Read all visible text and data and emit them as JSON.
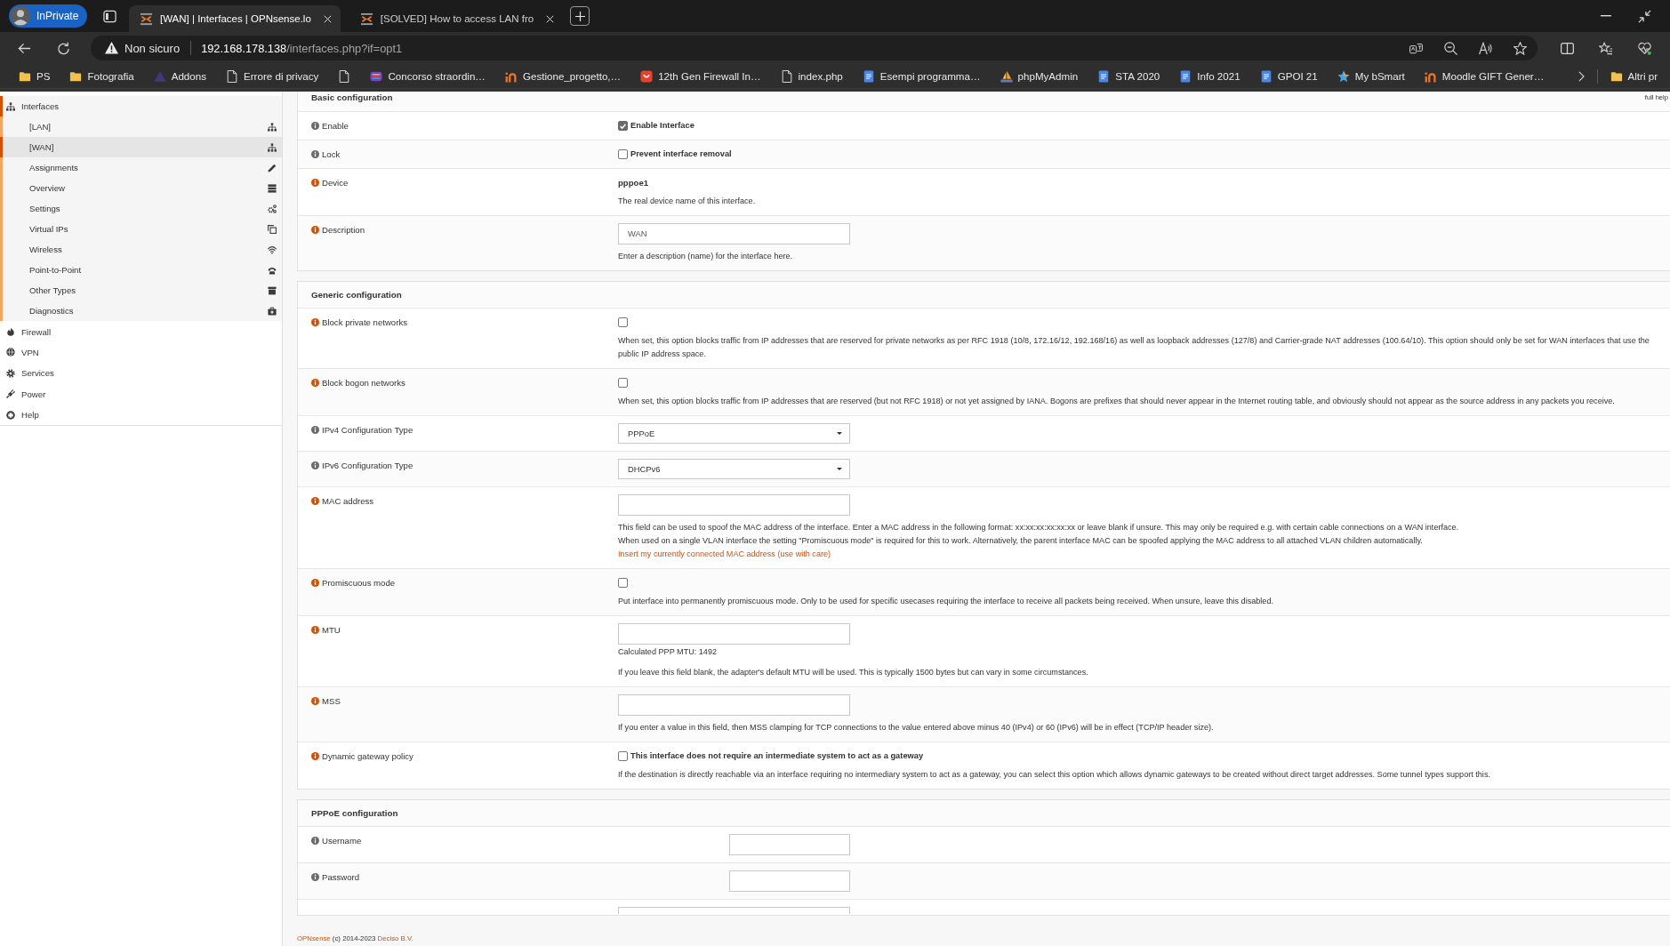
{
  "browser": {
    "profile": {
      "label": "InPrivate"
    },
    "tabs": [
      {
        "title": "[WAN] | Interfaces | OPNsense.lo",
        "selected": true
      },
      {
        "title": "[SOLVED] How to access LAN fro",
        "selected": false
      }
    ],
    "address": {
      "security": "Non sicuro",
      "host": "192.168.178.138",
      "path": "/interfaces.php?if=opt1"
    },
    "bookmarks": [
      {
        "kind": "folder",
        "label": "PS"
      },
      {
        "kind": "folder",
        "label": "Fotografia"
      },
      {
        "kind": "site",
        "label": "Addons"
      },
      {
        "kind": "page",
        "label": "Errore di privacy"
      },
      {
        "kind": "page"
      },
      {
        "kind": "site",
        "label": "Concorso straordin…"
      },
      {
        "kind": "site",
        "label": "Gestione_progetto,…"
      },
      {
        "kind": "site",
        "label": "12th Gen Firewall In…"
      },
      {
        "kind": "page",
        "label": "index.php"
      },
      {
        "kind": "doc",
        "label": "Esempi programma…"
      },
      {
        "kind": "site",
        "label": "phpMyAdmin"
      },
      {
        "kind": "doc",
        "label": "STA 2020"
      },
      {
        "kind": "doc",
        "label": "Info 2021"
      },
      {
        "kind": "doc",
        "label": "GPOI 21"
      },
      {
        "kind": "site",
        "label": "My bSmart"
      },
      {
        "kind": "site",
        "label": "Moodle GIFT Gener…"
      }
    ],
    "other_bookmarks": {
      "label": "Altri pr"
    }
  },
  "sidebar": {
    "sections": [
      {
        "label": "Interfaces",
        "expanded": true,
        "items": [
          {
            "label": "[LAN]",
            "selected": false
          },
          {
            "label": "[WAN]",
            "selected": true
          },
          {
            "label": "Assignments",
            "selected": false
          },
          {
            "label": "Overview",
            "selected": false
          },
          {
            "label": "Settings",
            "selected": false
          },
          {
            "label": "Virtual IPs",
            "selected": false
          },
          {
            "label": "Wireless",
            "selected": false
          },
          {
            "label": "Point-to-Point",
            "selected": false
          },
          {
            "label": "Other Types",
            "selected": false
          },
          {
            "label": "Diagnostics",
            "selected": false
          }
        ]
      },
      {
        "label": "Firewall",
        "expanded": false
      },
      {
        "label": "VPN",
        "expanded": false
      },
      {
        "label": "Services",
        "expanded": false
      },
      {
        "label": "Power",
        "expanded": false
      },
      {
        "label": "Help",
        "expanded": false
      }
    ]
  },
  "form": {
    "full_help": "full help",
    "sections": [
      {
        "title": "Basic configuration",
        "rows": [
          {
            "kind": "checkbox",
            "label": "Enable",
            "help": false,
            "checked": true,
            "text": "Enable Interface"
          },
          {
            "kind": "checkbox",
            "label": "Lock",
            "help": false,
            "checked": false,
            "text": "Prevent interface removal"
          },
          {
            "kind": "static",
            "label": "Device",
            "help": true,
            "value": "pppoe1",
            "hints": [
              "The real device name of this interface."
            ]
          },
          {
            "kind": "input",
            "label": "Description",
            "help": true,
            "value": "WAN",
            "hints": [
              "Enter a description (name) for the interface here."
            ]
          }
        ]
      },
      {
        "title": "Generic configuration",
        "rows": [
          {
            "kind": "checkbox",
            "label": "Block private networks",
            "help": true,
            "checked": false,
            "hints": [
              "When set, this option blocks traffic from IP addresses that are reserved for private networks as per RFC 1918 (10/8, 172.16/12, 192.168/16) as well as loopback addresses (127/8) and Carrier-grade NAT addresses (100.64/10). This option should only be set for WAN interfaces that use the public IP address space."
            ]
          },
          {
            "kind": "checkbox",
            "label": "Block bogon networks",
            "help": true,
            "checked": false,
            "hints": [
              "When set, this option blocks traffic from IP addresses that are reserved (but not RFC 1918) or not yet assigned by IANA. Bogons are prefixes that should never appear in the Internet routing table, and obviously should not appear as the source address in any packets you receive."
            ]
          },
          {
            "kind": "select",
            "label": "IPv4 Configuration Type",
            "help": false,
            "value": "PPPoE"
          },
          {
            "kind": "select",
            "label": "IPv6 Configuration Type",
            "help": false,
            "value": "DHCPv6"
          },
          {
            "kind": "input",
            "label": "MAC address",
            "help": true,
            "hints": [
              "This field can be used to spoof the MAC address of the interface. Enter a MAC address in the following format: xx:xx:xx:xx:xx:xx or leave blank if unsure. This may only be required e.g. with certain cable connections on a WAN interface.",
              "When used on a single VLAN interface the setting \"Promiscuous mode\" is required for this to work. Alternatively, the parent interface MAC can be spoofed applying the MAC address to all attached VLAN children automatically."
            ],
            "link": "Insert my currently connected MAC address (use with care)"
          },
          {
            "kind": "checkbox",
            "label": "Promiscuous mode",
            "help": true,
            "checked": false,
            "hints": [
              "Put interface into permanently promiscuous mode. Only to be used for specific usecases requiring the interface to receive all packets being received. When unsure, leave this disabled."
            ]
          },
          {
            "kind": "input",
            "label": "MTU",
            "help": true,
            "note": "Calculated PPP MTU: 1492",
            "hints": [
              "If you leave this field blank, the adapter's default MTU will be used. This is typically 1500 bytes but can vary in some circumstances."
            ]
          },
          {
            "kind": "input",
            "label": "MSS",
            "help": true,
            "hints": [
              "If you enter a value in this field, then MSS clamping for TCP connections to the value entered above minus 40 (IPv4) or 60 (IPv6) will be in effect (TCP/IP header size)."
            ]
          },
          {
            "kind": "checkbox",
            "label": "Dynamic gateway policy",
            "help": true,
            "checked": false,
            "text": "This interface does not require an intermediate system to act as a gateway",
            "hints": [
              "If the destination is directly reachable via an interface requiring no intermediary system to act as a gateway, you can select this option which allows dynamic gateways to be created without direct target addresses. Some tunnel types support this."
            ]
          }
        ]
      },
      {
        "title": "PPPoE configuration",
        "rows": [
          {
            "kind": "input",
            "label": "Username",
            "help": false
          },
          {
            "kind": "input",
            "label": "Password",
            "help": false
          },
          {
            "kind": "input"
          }
        ]
      }
    ]
  },
  "footer": {
    "product": "OPNsense",
    "copyright": "(c) 2014-2023",
    "company": "Deciso B.V."
  }
}
